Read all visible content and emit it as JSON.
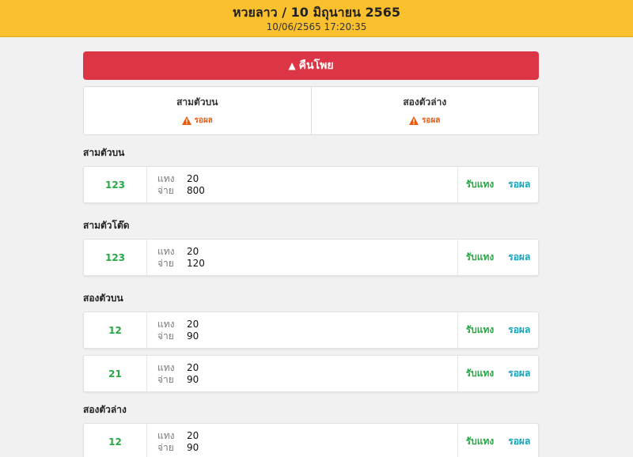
{
  "header": {
    "title": "หวยลาว / 10 มิถุนายน 2565",
    "datetime": "10/06/2565 17:20:35"
  },
  "refund_button": {
    "label": "คืนโพย"
  },
  "status": [
    {
      "label": "สามตัวบน",
      "state": "รอผล"
    },
    {
      "label": "สองตัวล่าง",
      "state": "รอผล"
    }
  ],
  "colors": {
    "header": "#fbc02d",
    "refund": "#dc3545",
    "warning": "#e8590c",
    "number": "#28a745",
    "wait": "#17a2b8"
  },
  "groups": [
    {
      "title": "สามตัวบน",
      "items": [
        {
          "number": "123",
          "bet_label": "แทง",
          "bet": "20",
          "pay_label": "จ่าย",
          "pay": "800",
          "receive_label": "รับแทง",
          "result_label": "รอผล"
        }
      ]
    },
    {
      "title": "สามตัวโต๊ด",
      "items": [
        {
          "number": "123",
          "bet_label": "แทง",
          "bet": "20",
          "pay_label": "จ่าย",
          "pay": "120",
          "receive_label": "รับแทง",
          "result_label": "รอผล"
        }
      ]
    },
    {
      "title": "สองตัวบน",
      "items": [
        {
          "number": "12",
          "bet_label": "แทง",
          "bet": "20",
          "pay_label": "จ่าย",
          "pay": "90",
          "receive_label": "รับแทง",
          "result_label": "รอผล"
        },
        {
          "number": "21",
          "bet_label": "แทง",
          "bet": "20",
          "pay_label": "จ่าย",
          "pay": "90",
          "receive_label": "รับแทง",
          "result_label": "รอผล"
        }
      ]
    },
    {
      "title": "สองตัวล่าง",
      "items": [
        {
          "number": "12",
          "bet_label": "แทง",
          "bet": "20",
          "pay_label": "จ่าย",
          "pay": "90",
          "receive_label": "รับแทง",
          "result_label": "รอผล"
        }
      ]
    }
  ]
}
